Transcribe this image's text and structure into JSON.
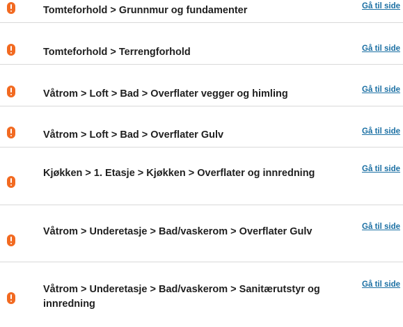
{
  "accent_color": "#f26a21",
  "link_color": "#1a6fa3",
  "icon": "warning-exclamation-icon",
  "items": [
    {
      "path": "Tomteforhold > Grunnmur og fundamenter",
      "link_label": "Gå til side"
    },
    {
      "path": "Tomteforhold > Terrengforhold",
      "link_label": "Gå til side"
    },
    {
      "path": "Våtrom > Loft > Bad  > Overflater vegger og himling",
      "link_label": "Gå til side"
    },
    {
      "path": "Våtrom > Loft > Bad  > Overflater Gulv",
      "link_label": "Gå til side"
    },
    {
      "path": "Kjøkken > 1. Etasje > Kjøkken  > Overflater og innredning",
      "link_label": "Gå til side"
    },
    {
      "path": "Våtrom > Underetasje > Bad/vaskerom  > Overflater Gulv",
      "link_label": "Gå til side"
    },
    {
      "path": "Våtrom > Underetasje > Bad/vaskerom  > Sanitærutstyr og innredning",
      "link_label": "Gå til side"
    }
  ]
}
